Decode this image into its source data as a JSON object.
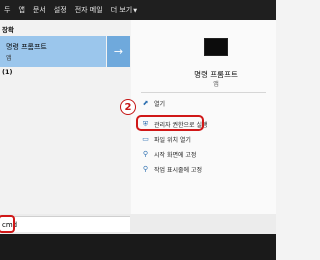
{
  "tabs": [
    "두",
    "앱",
    "문서",
    "설정",
    "전자 메일",
    "더 보기"
  ],
  "left": {
    "best_match_label": "장확",
    "best": {
      "title": "명령 프롬프트",
      "subtitle": "앱"
    },
    "second_label": "(1)",
    "arrow": "→"
  },
  "right": {
    "app_name": "명령 프롬프트",
    "app_type": "앱",
    "actions": [
      "열기",
      "관리자 권한으로 실행",
      "파일 위치 열기",
      "시작 화면에 고정",
      "작업 표시줄에 고정"
    ]
  },
  "annotation": {
    "step": "2"
  },
  "search": {
    "value": "cmd"
  },
  "colors": {
    "highlight": "#9bc6ec",
    "accent": "#6fa9dc",
    "annotation_red": "#d01818",
    "titlebar": "#1f1f1f"
  }
}
